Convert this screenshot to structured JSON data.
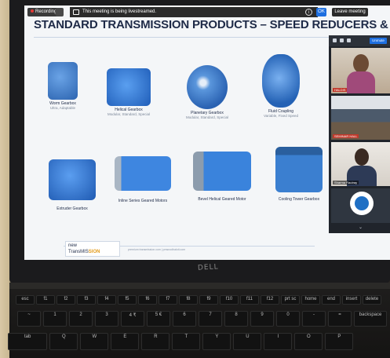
{
  "meeting_bar": {
    "recording_label": "Recording",
    "banner_text": "This meeting is being livestreamed.",
    "info_icon": "info-icon",
    "ok_label": "OK",
    "leave_label": "Leave meeting"
  },
  "slide": {
    "title": "STANDARD TRANSMISSION PRODUCTS – SPEED REDUCERS & FLUID COUPLINGS",
    "products": [
      {
        "name": "Worm Gearbox",
        "sub": "Ultra, Adaptable",
        "color": "#3f7fc7"
      },
      {
        "name": "Helical Gearbox",
        "sub": "Modular, Standard, Special",
        "color": "#2f7ad6"
      },
      {
        "name": "Planetary Gearbox",
        "sub": "Modular, Standard, Special",
        "color": "#3a78c8"
      },
      {
        "name": "Fluid Coupling",
        "sub": "Variable, Fixed Speed",
        "color": "#2e73cc"
      },
      {
        "name": "Extruder Gearbox",
        "sub": "",
        "color": "#2f74d0"
      },
      {
        "name": "Inline Series Geared Motors",
        "sub": "",
        "color": "#2b79d4"
      },
      {
        "name": "Bevel Helical Geared Motor",
        "sub": "",
        "color": "#2f76cf"
      },
      {
        "name": "Cooling Tower Gearbox",
        "sub": "",
        "color": "#2d6fb8"
      }
    ],
    "logo": {
      "line1": "new",
      "line2_a": "TransMIS",
      "line2_b": "SION"
    },
    "footer_text": "premium transmission.com  |  pmsnodhaloti.com"
  },
  "participants": {
    "unmute_label": "Unmute",
    "tiles": [
      {
        "label": "HALDIS"
      },
      {
        "label": "SEMINAR HALL"
      },
      {
        "label": "Sharma Rautray"
      },
      {
        "label": ""
      }
    ]
  },
  "laptop": {
    "brand": "DELL"
  },
  "keyboard": {
    "row1": [
      "esc",
      "f1",
      "f2",
      "f3",
      "f4",
      "f5",
      "f6",
      "f7",
      "f8",
      "f9",
      "f10",
      "f11",
      "f12",
      "prt sc",
      "home",
      "end",
      "insert",
      "delete"
    ],
    "row2": [
      "~",
      "1",
      "2",
      "3",
      "4 ₹",
      "5 €",
      "6",
      "7",
      "8",
      "9",
      "0",
      "-",
      "=",
      "backspace"
    ],
    "row3": [
      "tab",
      "Q",
      "W",
      "E",
      "R",
      "T",
      "Y",
      "U",
      "I",
      "O",
      "P"
    ]
  }
}
